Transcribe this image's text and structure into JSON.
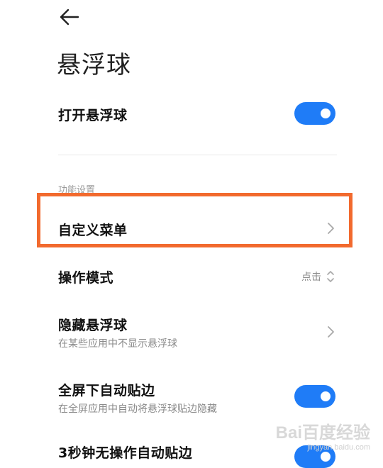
{
  "header": {
    "title": "悬浮球"
  },
  "master": {
    "label": "打开悬浮球",
    "enabled": true
  },
  "section": {
    "label": "功能设置"
  },
  "rows": {
    "custom_menu": {
      "label": "自定义菜单"
    },
    "mode": {
      "label": "操作模式",
      "value": "点击"
    },
    "hide": {
      "label": "隐藏悬浮球",
      "sub": "在某些应用中不显示悬浮球"
    },
    "fullscreen": {
      "label": "全屏下自动贴边",
      "sub": "在全屏应用中自动将悬浮球贴边隐藏",
      "enabled": true
    },
    "idle": {
      "label": "3秒钟无操作自动贴边",
      "enabled": true
    }
  },
  "watermark": {
    "brand": "Bai百度经验",
    "url": "jingyan.baidu.com"
  },
  "colors": {
    "accent": "#1f7cf7",
    "highlight": "#f26a2e"
  }
}
